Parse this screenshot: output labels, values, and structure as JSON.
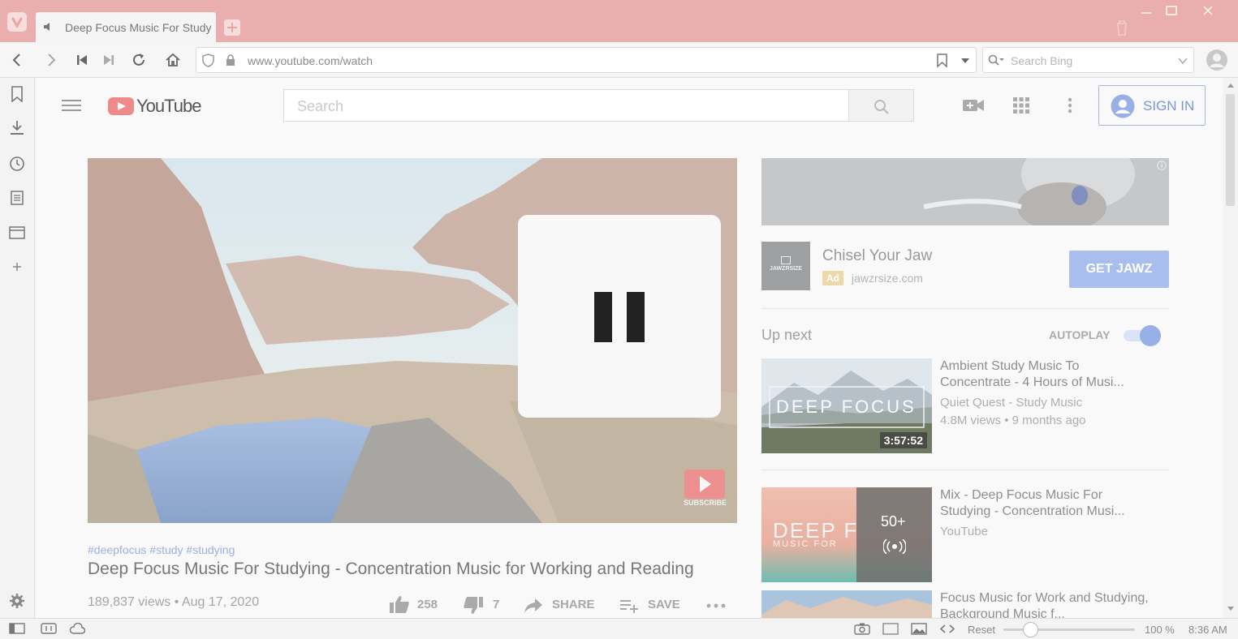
{
  "browser": {
    "tab_title": "Deep Focus Music For Studying",
    "url": "www.youtube.com/watch",
    "search_placeholder": "Search Bing",
    "status": {
      "reset_label": "Reset",
      "zoom": "100 %",
      "time": "8:36 AM"
    }
  },
  "youtube": {
    "logo_text": "YouTube",
    "search_placeholder": "Search",
    "signin_label": "SIGN IN",
    "video": {
      "hashtags": "#deepfocus #study #studying",
      "title": "Deep Focus Music For Studying - Concentration Music for Working and Reading",
      "meta": "189,837 views • Aug 17, 2020",
      "likes": "258",
      "dislikes": "7",
      "share_label": "SHARE",
      "save_label": "SAVE",
      "subscribe_watermark": "SUBSCRIBE"
    },
    "ad": {
      "title": "Chisel Your Jaw",
      "badge": "Ad",
      "domain": "jawzrsize.com",
      "cta": "GET JAWZ",
      "logo_text": "JAWZRSIZE"
    },
    "up_next": {
      "label": "Up next",
      "autoplay_label": "AUTOPLAY",
      "autoplay_on": true,
      "items": [
        {
          "title": "Ambient Study Music To Concentrate - 4 Hours of Musi...",
          "channel": "Quiet Quest - Study Music",
          "meta": "4.8M views • 9 months ago",
          "duration": "3:57:52",
          "thumb_text": "DEEP FOCUS"
        },
        {
          "title": "Mix - Deep Focus Music For Studying - Concentration Musi...",
          "channel": "YouTube",
          "playlist_count": "50+",
          "thumb_text": "DEEP F",
          "thumb_sub": "MUSIC FOR"
        },
        {
          "title": "Focus Music for Work and Studying, Background Music f..."
        }
      ]
    }
  },
  "colors": {
    "titlebar": "#ebaeae",
    "accent_blue": "#7a98d6",
    "ad_button": "#a8beec"
  }
}
